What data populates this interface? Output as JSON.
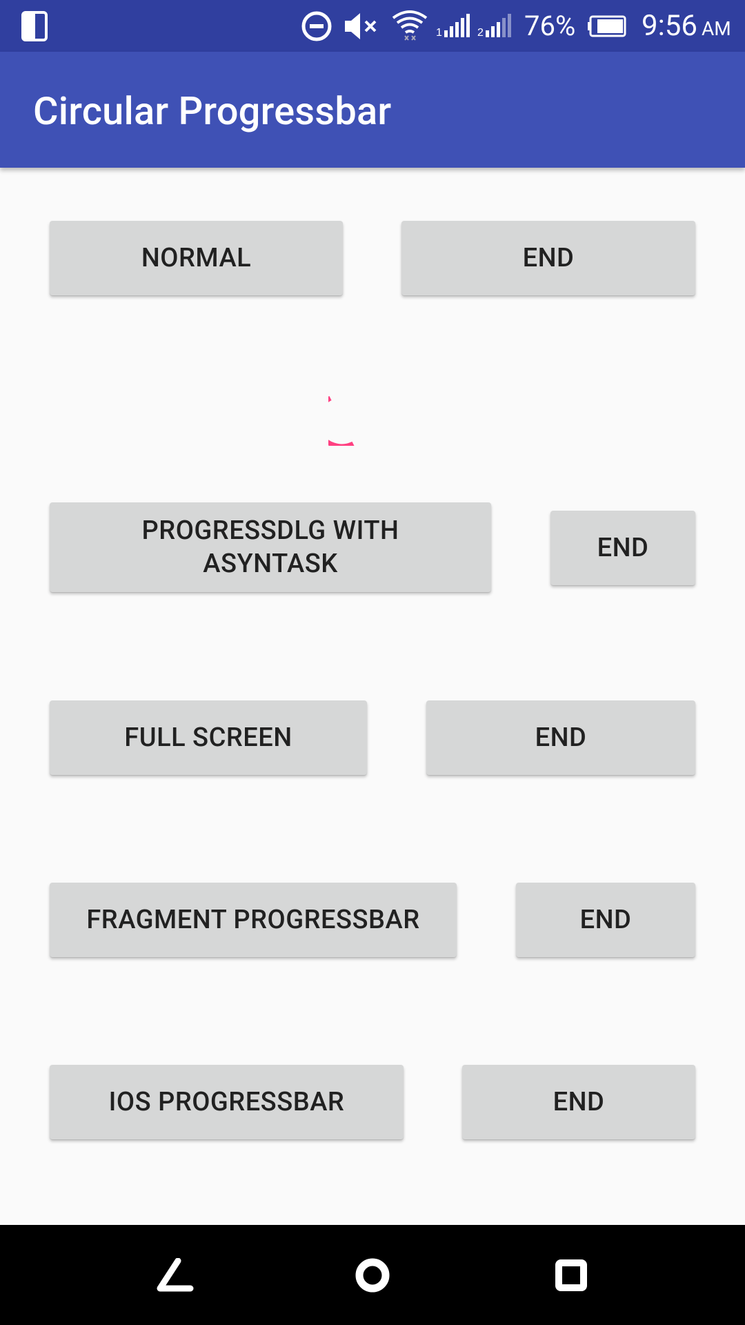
{
  "status_bar": {
    "battery_percent": "76%",
    "time": "9:56",
    "ampm": "AM",
    "icons": [
      "phone-device-icon",
      "do-not-disturb-icon",
      "mute-icon",
      "wifi-icon",
      "signal-sim1-icon",
      "signal-sim2-icon",
      "battery-icon"
    ]
  },
  "app_bar": {
    "title": "Circular Progressbar"
  },
  "rows": [
    {
      "start_label": "NORMAL",
      "end_label": "END"
    },
    {
      "start_label": "PROGRESSDLG WITH ASYNTASK",
      "end_label": "END"
    },
    {
      "start_label": "FULL SCREEN",
      "end_label": "END"
    },
    {
      "start_label": "FRAGMENT PROGRESSBAR",
      "end_label": "END"
    },
    {
      "start_label": "IOS PROGRESSBAR",
      "end_label": "END"
    }
  ],
  "spinner": {
    "color": "#ff4081"
  },
  "nav_bar": {
    "icons": [
      "back-icon",
      "home-icon",
      "recents-icon"
    ]
  },
  "colors": {
    "status_bar": "#303f9f",
    "app_bar": "#3f51b5",
    "button": "#d6d7d7",
    "accent": "#ff4081"
  }
}
